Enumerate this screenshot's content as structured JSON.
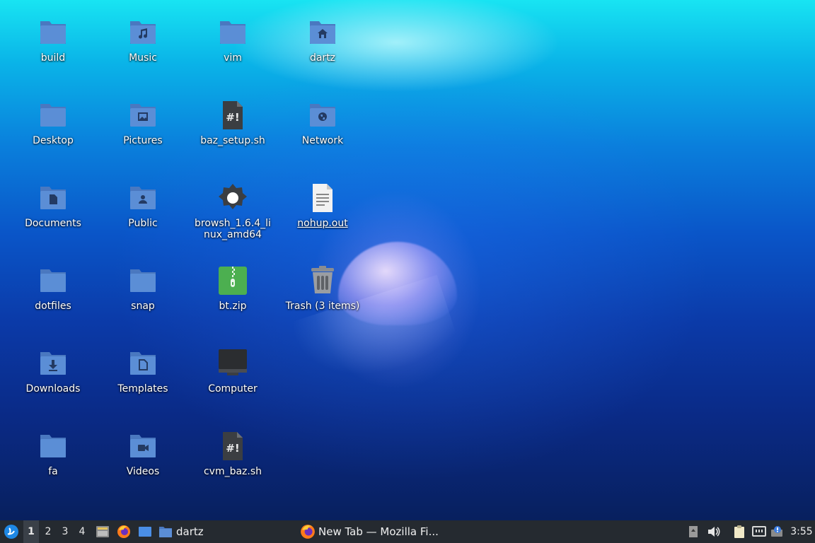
{
  "desktop": {
    "icons": [
      {
        "label": "build"
      },
      {
        "label": "Music"
      },
      {
        "label": "vim"
      },
      {
        "label": "dartz"
      },
      {
        "label": "Desktop"
      },
      {
        "label": "Pictures"
      },
      {
        "label": "baz_setup.sh"
      },
      {
        "label": "Network"
      },
      {
        "label": "Documents"
      },
      {
        "label": "Public"
      },
      {
        "label": "browsh_1.6.4_linux_amd64"
      },
      {
        "label": "nohup.out"
      },
      {
        "label": "dotfiles"
      },
      {
        "label": "snap"
      },
      {
        "label": "bt.zip"
      },
      {
        "label": "Trash (3 items)"
      },
      {
        "label": "Downloads"
      },
      {
        "label": "Templates"
      },
      {
        "label": "Computer"
      },
      {
        "label": "fa"
      },
      {
        "label": "Videos"
      },
      {
        "label": "cvm_baz.sh"
      }
    ]
  },
  "taskbar": {
    "workspaces": [
      "1",
      "2",
      "3",
      "4"
    ],
    "folder_task": "dartz",
    "browser_task": "New Tab — Mozilla Fi...",
    "clock": "3:55"
  },
  "colors": {
    "folder": "#5b8ed6",
    "folder_tab": "#4a78c0",
    "taskbar": "#252a30"
  }
}
